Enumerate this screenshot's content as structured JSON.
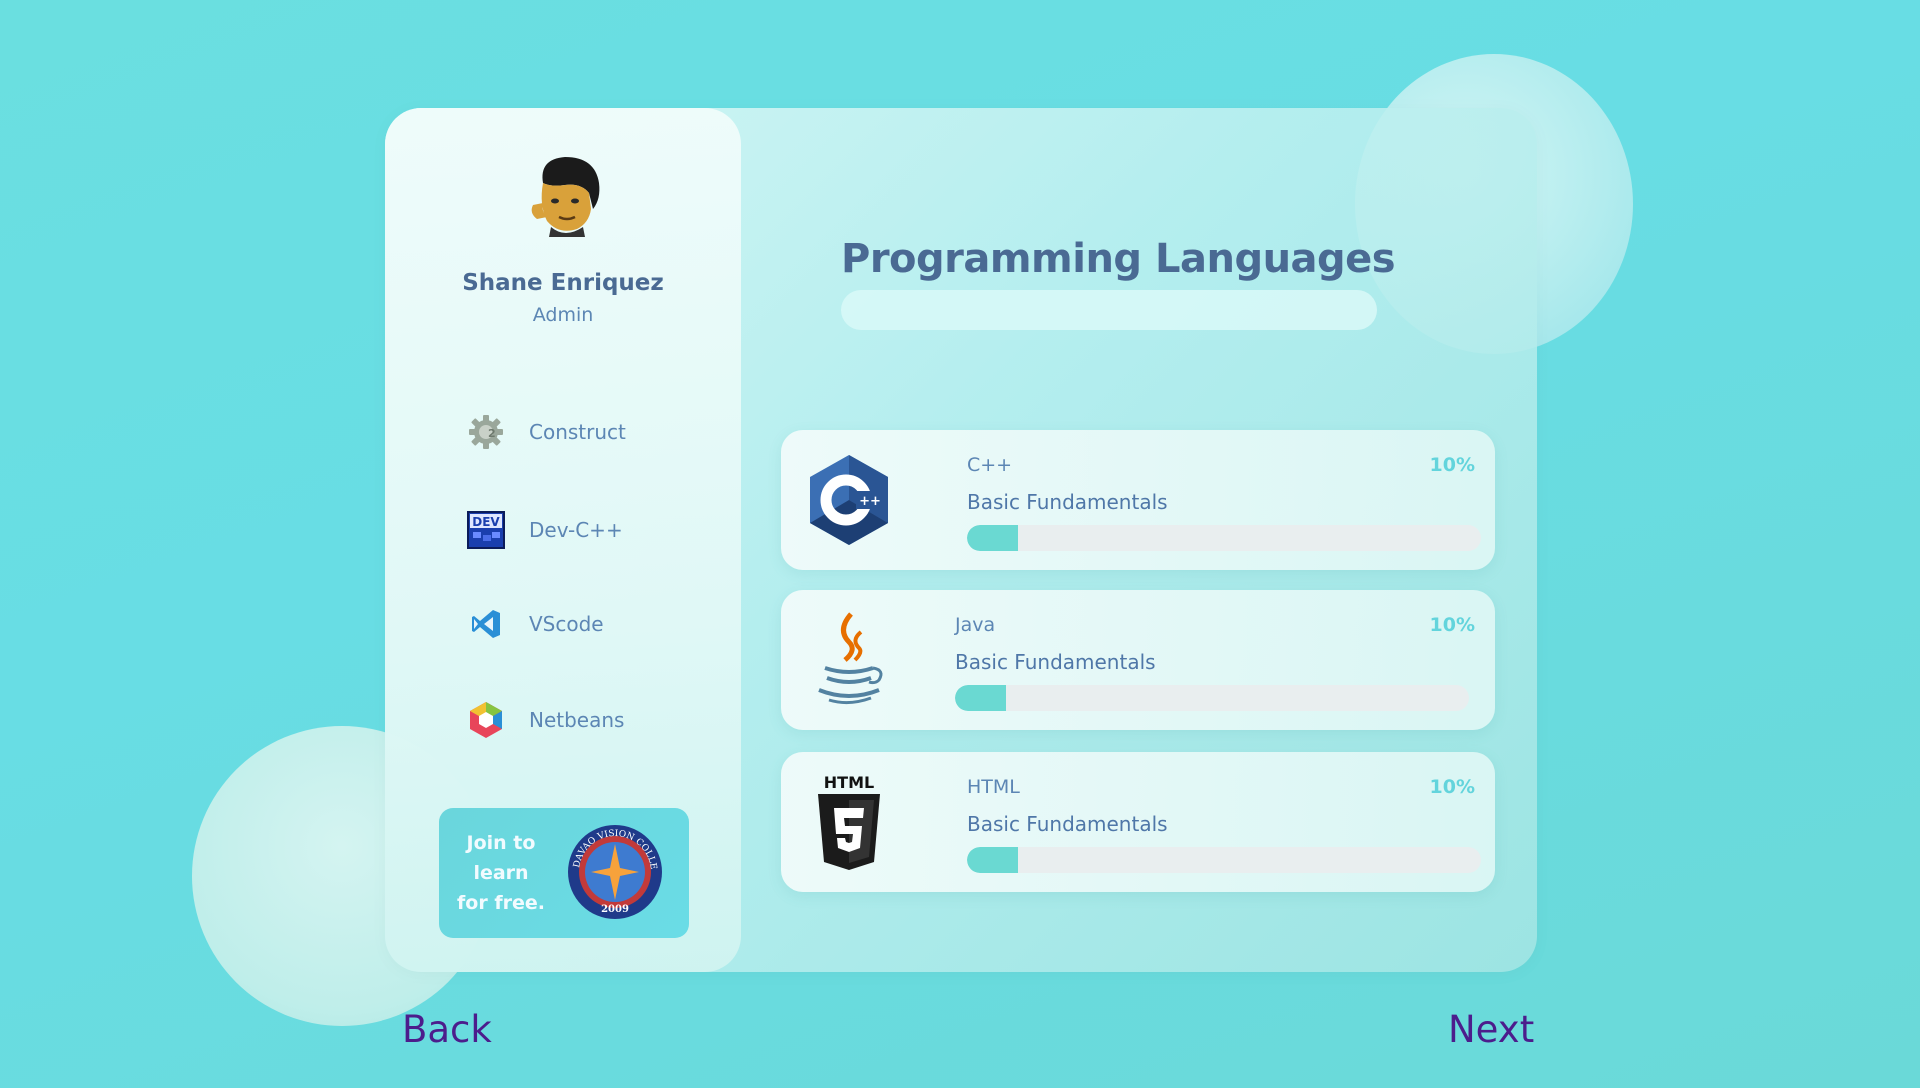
{
  "user": {
    "name": "Shane Enriquez",
    "role": "Admin"
  },
  "tools": [
    {
      "label": "Construct",
      "icon": "construct-gear-icon"
    },
    {
      "label": "Dev-C++",
      "icon": "dev-cpp-icon",
      "badge": "DEV"
    },
    {
      "label": "VScode",
      "icon": "vscode-icon"
    },
    {
      "label": "Netbeans",
      "icon": "netbeans-icon"
    }
  ],
  "promo": {
    "lines": [
      "Join to",
      "learn",
      "for free."
    ],
    "logo_text": "DAVAO VISION COLLEGES",
    "logo_year": "2009"
  },
  "main": {
    "title": "Programming Languages"
  },
  "languages": [
    {
      "name": "C++",
      "subtitle": "Basic Fundamentals",
      "percent_label": "10%",
      "progress": 0.1,
      "icon": "cpp-icon"
    },
    {
      "name": "Java",
      "subtitle": "Basic Fundamentals",
      "percent_label": "10%",
      "progress": 0.1,
      "icon": "java-icon"
    },
    {
      "name": "HTML",
      "subtitle": "Basic Fundamentals",
      "percent_label": "10%",
      "progress": 0.1,
      "icon": "html5-icon",
      "icon_text": "HTML"
    }
  ],
  "nav": {
    "back_label": "Back",
    "next_label": "Next"
  },
  "colors": {
    "accent": "#6ad9d2",
    "title": "#4a6a93",
    "nav": "#4c1d8c",
    "percent": "#63d4dc"
  }
}
